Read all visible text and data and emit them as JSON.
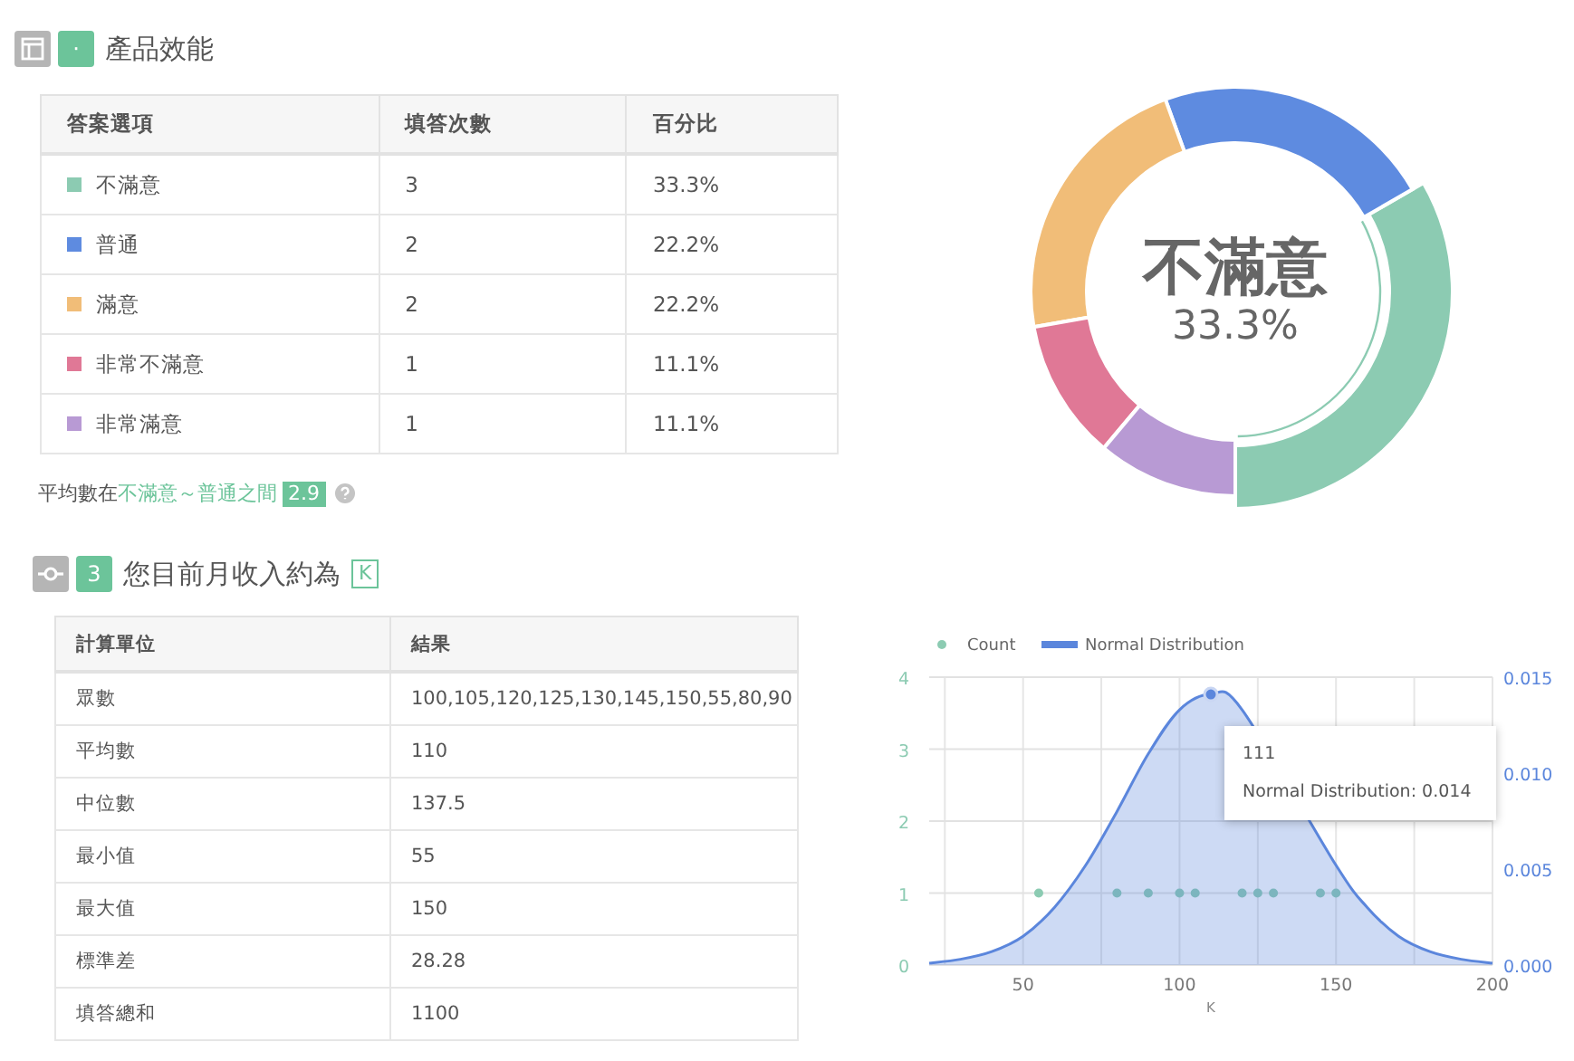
{
  "performance": {
    "badge": "·",
    "title": "產品效能",
    "columns": [
      "答案選項",
      "填答次數",
      "百分比"
    ],
    "rows": [
      {
        "label": "不滿意",
        "count": "3",
        "percent": "33.3%",
        "color": "#8ccbb2"
      },
      {
        "label": "普通",
        "count": "2",
        "percent": "22.2%",
        "color": "#5e8be0"
      },
      {
        "label": "滿意",
        "count": "2",
        "percent": "22.2%",
        "color": "#f1bd78"
      },
      {
        "label": "非常不滿意",
        "count": "1",
        "percent": "11.1%",
        "color": "#e07896"
      },
      {
        "label": "非常滿意",
        "count": "1",
        "percent": "11.1%",
        "color": "#b89ad4"
      }
    ],
    "average": {
      "prefix": "平均數在",
      "range": "不滿意～普通之間",
      "value": "2.9"
    },
    "donut": {
      "center_label": "不滿意",
      "center_value": "33.3%"
    }
  },
  "income": {
    "badge": "3",
    "title": "您目前月收入約為",
    "unit": "K",
    "columns": [
      "計算單位",
      "結果"
    ],
    "rows": [
      [
        "眾數",
        "100,105,120,125,130,145,150,55,80,90"
      ],
      [
        "平均數",
        "110"
      ],
      [
        "中位數",
        "137.5"
      ],
      [
        "最小值",
        "55"
      ],
      [
        "最大值",
        "150"
      ],
      [
        "標準差",
        "28.28"
      ],
      [
        "填答總和",
        "1100"
      ]
    ],
    "count_chart": {
      "chart_data": {
        "type": "scatter",
        "xlabel": "K",
        "xlim": [
          20,
          200
        ],
        "ylim": [
          0,
          4
        ],
        "xticks": [
          50,
          100,
          150,
          200
        ],
        "yticks": [
          0,
          1,
          2,
          3,
          4
        ],
        "grid": true,
        "series": [
          {
            "name": "Count",
            "color": "#8ccbb2",
            "x": [
              55,
              80,
              90,
              100,
              105,
              120,
              125,
              130,
              145,
              150
            ],
            "values": [
              1,
              1,
              1,
              1,
              1,
              1,
              1,
              1,
              1,
              1
            ]
          }
        ]
      }
    },
    "distribution_chart": {
      "tooltip_title": "111",
      "chart_data": {
        "type": "area",
        "xlim": [
          20,
          200
        ],
        "ylim": [
          0,
          0.015
        ],
        "yticks": [
          {
            "value": 0,
            "label": "0.000"
          },
          {
            "value": 0.005,
            "label": "0.005"
          },
          {
            "value": 0.01,
            "label": "0.010"
          },
          {
            "value": 0.015,
            "label": "0.015"
          }
        ],
        "series": [
          {
            "name": "Normal Distribution",
            "color": "#5b86dc",
            "x": [
              20,
              30,
              40,
              50,
              60,
              70,
              80,
              90,
              100,
              110,
              120,
              130,
              140,
              150,
              160,
              170,
              180,
              190,
              200
            ],
            "values": [
              0.0001,
              0.0003,
              0.0007,
              0.0015,
              0.003,
              0.0052,
              0.008,
              0.011,
              0.0133,
              0.0141,
              0.0133,
              null,
              null,
              0.0052,
              0.003,
              0.0015,
              0.0007,
              0.0003,
              0.0001
            ]
          }
        ],
        "annotations": [
          "Normal Distribution: 0.014"
        ]
      }
    }
  }
}
